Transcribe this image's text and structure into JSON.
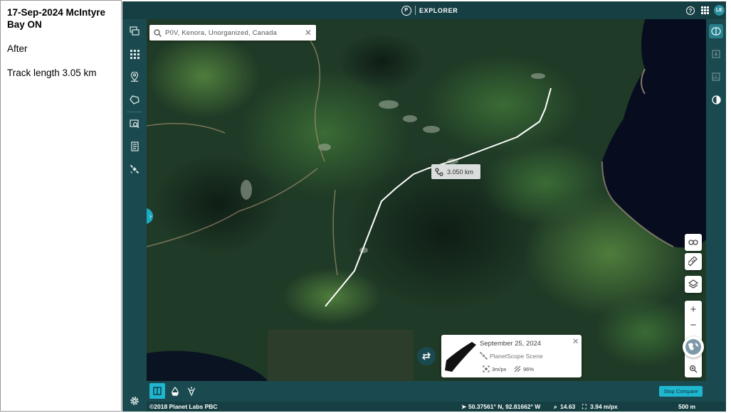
{
  "annotation": {
    "title": "17-Sep-2024 McIntyre Bay ON",
    "state": "After",
    "track_length_text": "Track length 3.05 km"
  },
  "app": {
    "title": "EXPLORER",
    "logo_letter": "P",
    "user_initials": "LE"
  },
  "search": {
    "value": "P0V, Kenora, Unorganized, Canada"
  },
  "measurement": {
    "distance": "3.050 km"
  },
  "scene": {
    "date": "September 25, 2024",
    "source": "PlanetScope Scene",
    "resolution": "3m/px",
    "coverage": "96%"
  },
  "bottom_bar": {
    "stop_compare_label": "Stop Compare"
  },
  "status": {
    "copyright": "©2018 Planet Labs PBC",
    "coordinates": "50.37561° N, 92.81662° W",
    "zoom_level": "14.63",
    "resolution": "3.94 m/px",
    "scale": "500 m"
  },
  "colors": {
    "app_bg": "#163f44",
    "accent": "#1fb6d0",
    "lake": "#070c1e",
    "forest": "#1f3a26"
  },
  "icons": {
    "sidebar": [
      "layers-stack-icon",
      "grid-icon",
      "location-pin-icon",
      "polygon-icon",
      "image-search-icon",
      "document-icon",
      "satellite-icon",
      "settings-icon"
    ],
    "rail": [
      "compare-icon",
      "download-icon",
      "analysis-icon",
      "contrast-icon"
    ]
  }
}
